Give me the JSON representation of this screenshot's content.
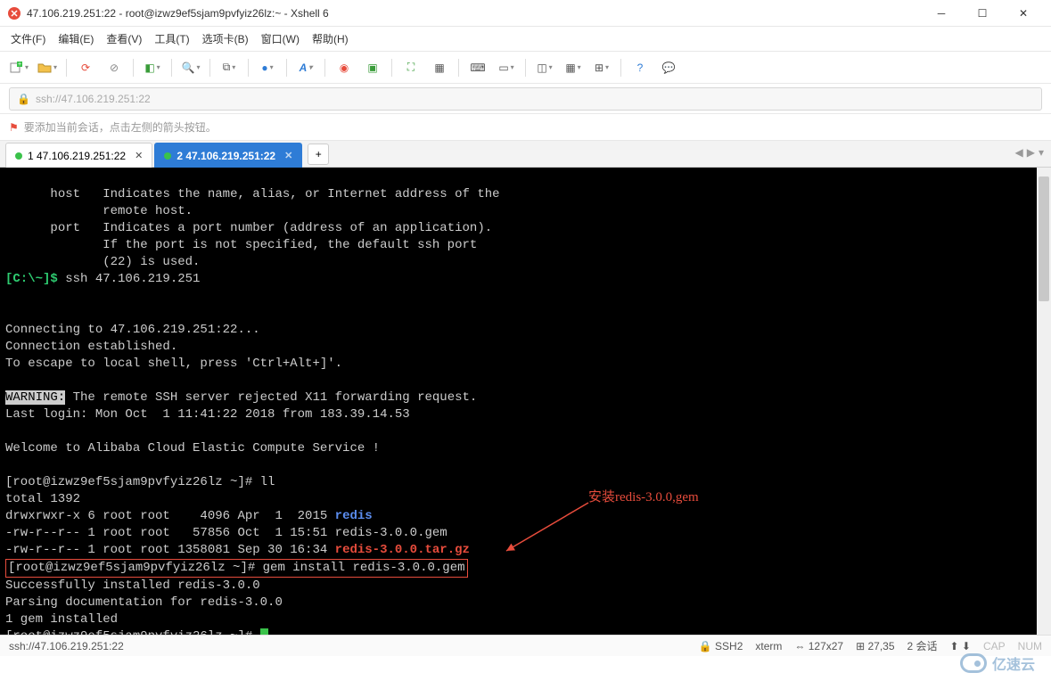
{
  "window": {
    "title": "47.106.219.251:22 - root@izwz9ef5sjam9pvfyiz26lz:~ - Xshell 6"
  },
  "menu": {
    "file": "文件(F)",
    "edit": "编辑(E)",
    "view": "查看(V)",
    "tools": "工具(T)",
    "tab": "选项卡(B)",
    "window": "窗口(W)",
    "help": "帮助(H)"
  },
  "address": {
    "placeholder": "ssh://47.106.219.251:22"
  },
  "hint": {
    "text": "要添加当前会话，点击左侧的箭头按钮。"
  },
  "tabs": [
    {
      "label": "1 47.106.219.251:22",
      "active": false
    },
    {
      "label": "2 47.106.219.251:22",
      "active": true
    }
  ],
  "terminal": {
    "help_host_label": "host",
    "help_host_l1": "Indicates the name, alias, or Internet address of the",
    "help_host_l2": "remote host.",
    "help_port_label": "port",
    "help_port_l1": "Indicates a port number (address of an application).",
    "help_port_l2": "If the port is not specified, the default ssh port",
    "help_port_l3": "(22) is used.",
    "local_prompt": "[C:\\~]$",
    "ssh_cmd": "ssh 47.106.219.251",
    "connecting": "Connecting to 47.106.219.251:22...",
    "conn_est": "Connection established.",
    "escape": "To escape to local shell, press 'Ctrl+Alt+]'.",
    "warn_label": "WARNING:",
    "warn_text": " The remote SSH server rejected X11 forwarding request.",
    "last_login": "Last login: Mon Oct  1 11:41:22 2018 from 183.39.14.53",
    "welcome": "Welcome to Alibaba Cloud Elastic Compute Service !",
    "prompt1": "[root@izwz9ef5sjam9pvfyiz26lz ~]# ",
    "cmd_ll": "ll",
    "total": "total 1392",
    "ls1_pre": "drwxrwxr-x 6 root root    4096 Apr  1  2015 ",
    "ls1_file": "redis",
    "ls2": "-rw-r--r-- 1 root root   57856 Oct  1 15:51 redis-3.0.0.gem",
    "ls3_pre": "-rw-r--r-- 1 root root 1358081 Sep 30 16:34 ",
    "ls3_file": "redis-3.0.0.tar.gz",
    "prompt2": "[root@izwz9ef5sjam9pvfyiz26lz ~]# ",
    "cmd_gem": "gem install redis-3.0.0.gem",
    "success": "Successfully installed redis-3.0.0",
    "parsing": "Parsing documentation for redis-3.0.0",
    "installed": "1 gem installed",
    "prompt3": "[root@izwz9ef5sjam9pvfyiz26lz ~]# ",
    "annotation": "安装redis-3.0.0,gem"
  },
  "status": {
    "left": "ssh://47.106.219.251:22",
    "ssh": "SSH2",
    "term": "xterm",
    "size": "127x27",
    "pos": "27,35",
    "sessions": "2 会话",
    "cap": "CAP",
    "num": "NUM"
  },
  "watermark": "亿速云"
}
